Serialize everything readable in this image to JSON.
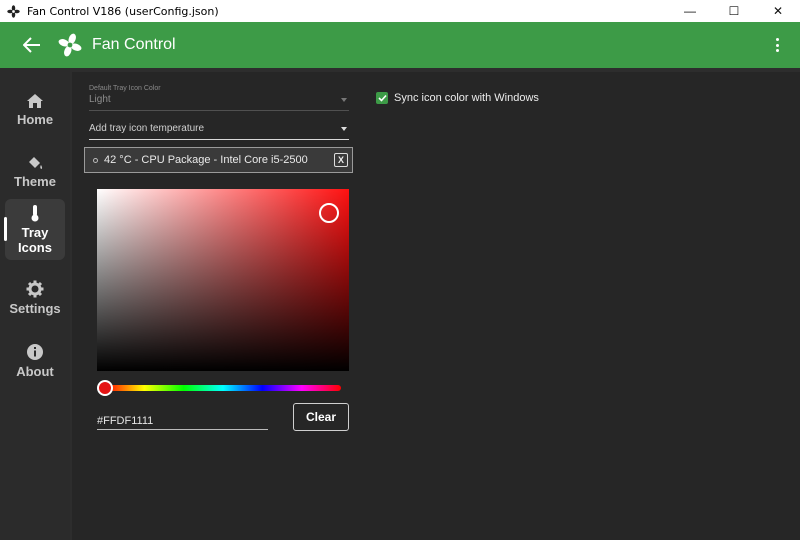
{
  "window": {
    "title": "Fan Control V186 (userConfig.json)",
    "minimize_glyph": "—",
    "maximize_glyph": "☐",
    "close_glyph": "✕"
  },
  "header": {
    "title": "Fan Control",
    "back_icon": "arrow-left-icon",
    "menu_icon": "more-vertical-icon",
    "accent_color": "#3d9b47"
  },
  "sidebar": {
    "items": [
      {
        "label": "Home",
        "icon": "home-icon",
        "active": false
      },
      {
        "label": "Theme",
        "icon": "paint-bucket-icon",
        "active": false
      },
      {
        "label": "Tray\nIcons",
        "icon": "thermometer-icon",
        "active": true
      },
      {
        "label": "Settings",
        "icon": "gear-icon",
        "active": false
      },
      {
        "label": "About",
        "icon": "info-icon",
        "active": false
      }
    ]
  },
  "tray": {
    "default_color_caption": "Default Tray Icon Color",
    "default_color_value": "Light",
    "add_placeholder": "Add tray icon temperature",
    "sensor_chip": "42 °C - CPU Package - Intel Core i5-2500",
    "chip_remove": "X",
    "hex_value": "#FFDF1111",
    "selected_color": "#ff1111",
    "clear_label": "Clear",
    "sync_label": "Sync icon color with Windows",
    "sync_checked": true
  }
}
